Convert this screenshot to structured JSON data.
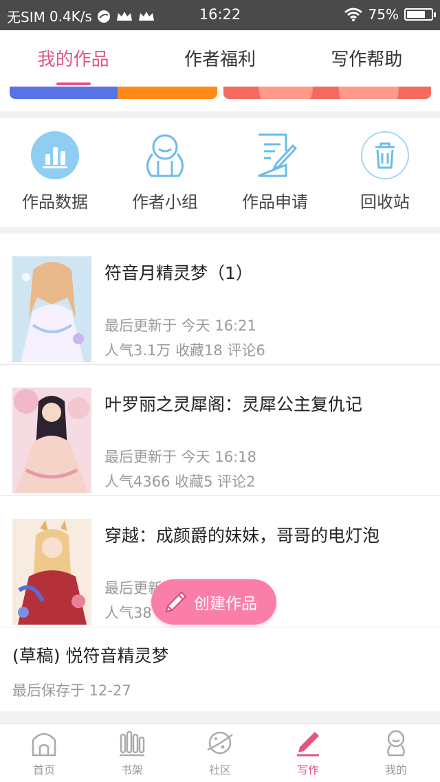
{
  "status_bar": {
    "carrier": "无SIM",
    "speed": "0.4K/s",
    "time": "16:22",
    "battery": "75%",
    "battery_level": 0.75
  },
  "tabs": [
    {
      "label": "我的作品",
      "active": true
    },
    {
      "label": "作者福利",
      "active": false
    },
    {
      "label": "写作帮助",
      "active": false
    }
  ],
  "quick_actions": [
    {
      "label": "作品数据",
      "icon": "chart-icon"
    },
    {
      "label": "作者小组",
      "icon": "group-icon"
    },
    {
      "label": "作品申请",
      "icon": "edit-document-icon"
    },
    {
      "label": "回收站",
      "icon": "trash-icon"
    }
  ],
  "works": [
    {
      "title": "符音月精灵梦（1）",
      "updated": "最后更新于 今天 16:21",
      "stats": "人气3.1万 收藏18 评论6"
    },
    {
      "title": "叶罗丽之灵犀阁：灵犀公主复仇记",
      "updated": "最后更新于 今天 16:18",
      "stats": "人气4366 收藏5 评论2"
    },
    {
      "title": "穿越：成颜爵的妹妹，哥哥的电灯泡",
      "updated": "最后更新",
      "stats": "人气38"
    }
  ],
  "draft": {
    "title": "(草稿) 悦符音精灵梦",
    "saved": "最后保存于 12-27"
  },
  "fab": {
    "label": "创建作品"
  },
  "bottom_nav": [
    {
      "label": "首页",
      "icon": "home-icon"
    },
    {
      "label": "书架",
      "icon": "bookshelf-icon"
    },
    {
      "label": "社区",
      "icon": "planet-icon"
    },
    {
      "label": "写作",
      "icon": "pen-icon",
      "active": true
    },
    {
      "label": "我的",
      "icon": "profile-icon"
    }
  ],
  "colors": {
    "accent": "#e2557f",
    "fab": "#fb7ea8",
    "icon_blue": "#67bdea"
  }
}
